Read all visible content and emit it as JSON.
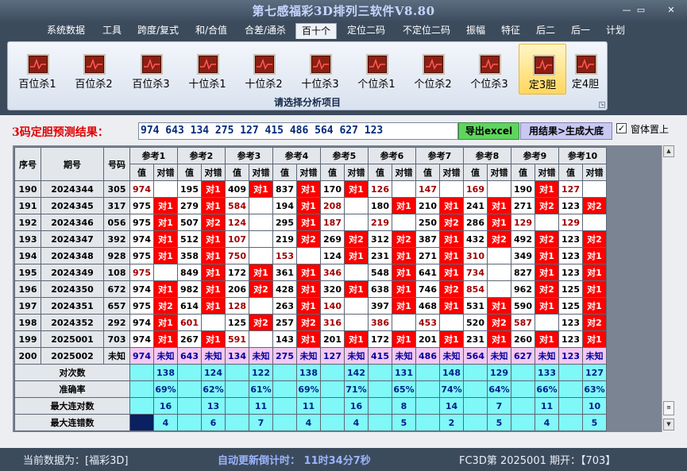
{
  "window": {
    "title": "第七感福彩3D排列三软件V8.80",
    "min": "—",
    "max": "▭",
    "close": "✕"
  },
  "menu": [
    "系统数据",
    "工具",
    "跨度/复式",
    "和/合值",
    "合差/通杀",
    "百十个",
    "定位二码",
    "不定位二码",
    "振幅",
    "特征",
    "后二",
    "后一",
    "计划"
  ],
  "menu_active": 5,
  "toolbar": {
    "items": [
      {
        "label": "百位杀1",
        "icon": "chart-icon"
      },
      {
        "label": "百位杀2",
        "icon": "chart-icon"
      },
      {
        "label": "百位杀3",
        "icon": "chart-icon"
      },
      {
        "label": "十位杀1",
        "icon": "chart-icon"
      },
      {
        "label": "十位杀2",
        "icon": "chart-icon"
      },
      {
        "label": "十位杀3",
        "icon": "chart-icon"
      },
      {
        "label": "个位杀1",
        "icon": "chart-icon"
      },
      {
        "label": "个位杀2",
        "icon": "chart-icon"
      },
      {
        "label": "个位杀3",
        "icon": "chart-icon"
      },
      {
        "label": "定3胆",
        "icon": "chart-icon"
      },
      {
        "label": "定4胆",
        "icon": "chart-icon"
      }
    ],
    "selected": 9,
    "section_title": "请选择分析项目"
  },
  "result": {
    "label": "3码定胆预测结果：",
    "value": "974 643 134 275 127 415 486 564 627 123",
    "export_button": "导出excel",
    "generate_button": "用结果>生成大底",
    "pin_label": "窗体置上",
    "pin_checked": "✓"
  },
  "grid": {
    "headers": {
      "no": "序号",
      "period": "期号",
      "draw": "号码",
      "ref": [
        "参考1",
        "参考2",
        "参考3",
        "参考4",
        "参考5",
        "参考6",
        "参考7",
        "参考8",
        "参考9",
        "参考10"
      ],
      "value": "值",
      "result": "对错"
    },
    "rows": [
      {
        "no": "190",
        "period": "2024344",
        "draw": "305",
        "cells": [
          [
            "974",
            ""
          ],
          [
            "195",
            "对1"
          ],
          [
            "409",
            "对1"
          ],
          [
            "837",
            "对1"
          ],
          [
            "170",
            "对1"
          ],
          [
            "126",
            ""
          ],
          [
            "147",
            ""
          ],
          [
            "169",
            ""
          ],
          [
            "190",
            "对1"
          ],
          [
            "127",
            ""
          ]
        ]
      },
      {
        "no": "191",
        "period": "2024345",
        "draw": "317",
        "cells": [
          [
            "975",
            "对1"
          ],
          [
            "279",
            "对1"
          ],
          [
            "584",
            ""
          ],
          [
            "194",
            "对1"
          ],
          [
            "208",
            ""
          ],
          [
            "180",
            "对1"
          ],
          [
            "210",
            "对1"
          ],
          [
            "241",
            "对1"
          ],
          [
            "271",
            "对2"
          ],
          [
            "123",
            "对2"
          ]
        ]
      },
      {
        "no": "192",
        "period": "2024346",
        "draw": "056",
        "cells": [
          [
            "975",
            "对1"
          ],
          [
            "507",
            "对2"
          ],
          [
            "124",
            ""
          ],
          [
            "295",
            "对1"
          ],
          [
            "187",
            ""
          ],
          [
            "219",
            ""
          ],
          [
            "250",
            "对2"
          ],
          [
            "286",
            "对1"
          ],
          [
            "129",
            ""
          ],
          [
            "129",
            ""
          ]
        ]
      },
      {
        "no": "193",
        "period": "2024347",
        "draw": "392",
        "cells": [
          [
            "974",
            "对1"
          ],
          [
            "512",
            "对1"
          ],
          [
            "107",
            ""
          ],
          [
            "219",
            "对2"
          ],
          [
            "269",
            "对2"
          ],
          [
            "312",
            "对2"
          ],
          [
            "387",
            "对1"
          ],
          [
            "432",
            "对2"
          ],
          [
            "492",
            "对2"
          ],
          [
            "123",
            "对2"
          ]
        ]
      },
      {
        "no": "194",
        "period": "2024348",
        "draw": "928",
        "cells": [
          [
            "975",
            "对1"
          ],
          [
            "358",
            "对1"
          ],
          [
            "750",
            ""
          ],
          [
            "153",
            ""
          ],
          [
            "124",
            "对1"
          ],
          [
            "231",
            "对1"
          ],
          [
            "271",
            "对1"
          ],
          [
            "310",
            ""
          ],
          [
            "349",
            "对1"
          ],
          [
            "123",
            "对1"
          ]
        ]
      },
      {
        "no": "195",
        "period": "2024349",
        "draw": "108",
        "cells": [
          [
            "975",
            ""
          ],
          [
            "849",
            "对1"
          ],
          [
            "172",
            "对1"
          ],
          [
            "361",
            "对1"
          ],
          [
            "346",
            ""
          ],
          [
            "548",
            "对1"
          ],
          [
            "641",
            "对1"
          ],
          [
            "734",
            ""
          ],
          [
            "827",
            "对1"
          ],
          [
            "123",
            "对1"
          ]
        ]
      },
      {
        "no": "196",
        "period": "2024350",
        "draw": "672",
        "cells": [
          [
            "974",
            "对1"
          ],
          [
            "982",
            "对1"
          ],
          [
            "206",
            "对2"
          ],
          [
            "428",
            "对1"
          ],
          [
            "320",
            "对1"
          ],
          [
            "638",
            "对1"
          ],
          [
            "746",
            "对2"
          ],
          [
            "854",
            ""
          ],
          [
            "962",
            "对2"
          ],
          [
            "125",
            "对1"
          ]
        ]
      },
      {
        "no": "197",
        "period": "2024351",
        "draw": "657",
        "cells": [
          [
            "975",
            "对2"
          ],
          [
            "614",
            "对1"
          ],
          [
            "128",
            ""
          ],
          [
            "263",
            "对1"
          ],
          [
            "140",
            ""
          ],
          [
            "397",
            "对1"
          ],
          [
            "468",
            "对1"
          ],
          [
            "531",
            "对1"
          ],
          [
            "590",
            "对1"
          ],
          [
            "125",
            "对1"
          ]
        ]
      },
      {
        "no": "198",
        "period": "2024352",
        "draw": "292",
        "cells": [
          [
            "974",
            "对1"
          ],
          [
            "601",
            ""
          ],
          [
            "125",
            "对2"
          ],
          [
            "257",
            "对2"
          ],
          [
            "316",
            ""
          ],
          [
            "386",
            ""
          ],
          [
            "453",
            ""
          ],
          [
            "520",
            "对2"
          ],
          [
            "587",
            ""
          ],
          [
            "123",
            "对2"
          ]
        ]
      },
      {
        "no": "199",
        "period": "2025001",
        "draw": "703",
        "cells": [
          [
            "974",
            "对1"
          ],
          [
            "267",
            "对1"
          ],
          [
            "591",
            ""
          ],
          [
            "143",
            "对1"
          ],
          [
            "201",
            "对1"
          ],
          [
            "172",
            "对1"
          ],
          [
            "201",
            "对1"
          ],
          [
            "231",
            "对1"
          ],
          [
            "260",
            "对1"
          ],
          [
            "123",
            "对1"
          ]
        ]
      }
    ],
    "pred_row": {
      "no": "200",
      "period": "2025002",
      "draw": "未知",
      "cells": [
        [
          "974",
          "未知"
        ],
        [
          "643",
          "未知"
        ],
        [
          "134",
          "未知"
        ],
        [
          "275",
          "未知"
        ],
        [
          "127",
          "未知"
        ],
        [
          "415",
          "未知"
        ],
        [
          "486",
          "未知"
        ],
        [
          "564",
          "未知"
        ],
        [
          "627",
          "未知"
        ],
        [
          "123",
          "未知"
        ]
      ]
    },
    "stats": [
      {
        "label": "对次数",
        "values": [
          "138",
          "124",
          "122",
          "138",
          "142",
          "131",
          "148",
          "129",
          "133",
          "127"
        ]
      },
      {
        "label": "准确率",
        "values": [
          "69%",
          "62%",
          "61%",
          "69%",
          "71%",
          "65%",
          "74%",
          "64%",
          "66%",
          "63%"
        ]
      },
      {
        "label": "最大连对数",
        "values": [
          "16",
          "13",
          "11",
          "11",
          "16",
          "8",
          "14",
          "7",
          "11",
          "10"
        ]
      },
      {
        "label": "最大连错数",
        "values": [
          "4",
          "6",
          "7",
          "4",
          "4",
          "5",
          "2",
          "5",
          "4",
          "5"
        ]
      }
    ]
  },
  "status": {
    "current": "当前数据为：[福彩3D]",
    "auto": "自动更新倒计时：  11时34分7秒",
    "fc": "FC3D第 2025001 期开：【703】"
  }
}
